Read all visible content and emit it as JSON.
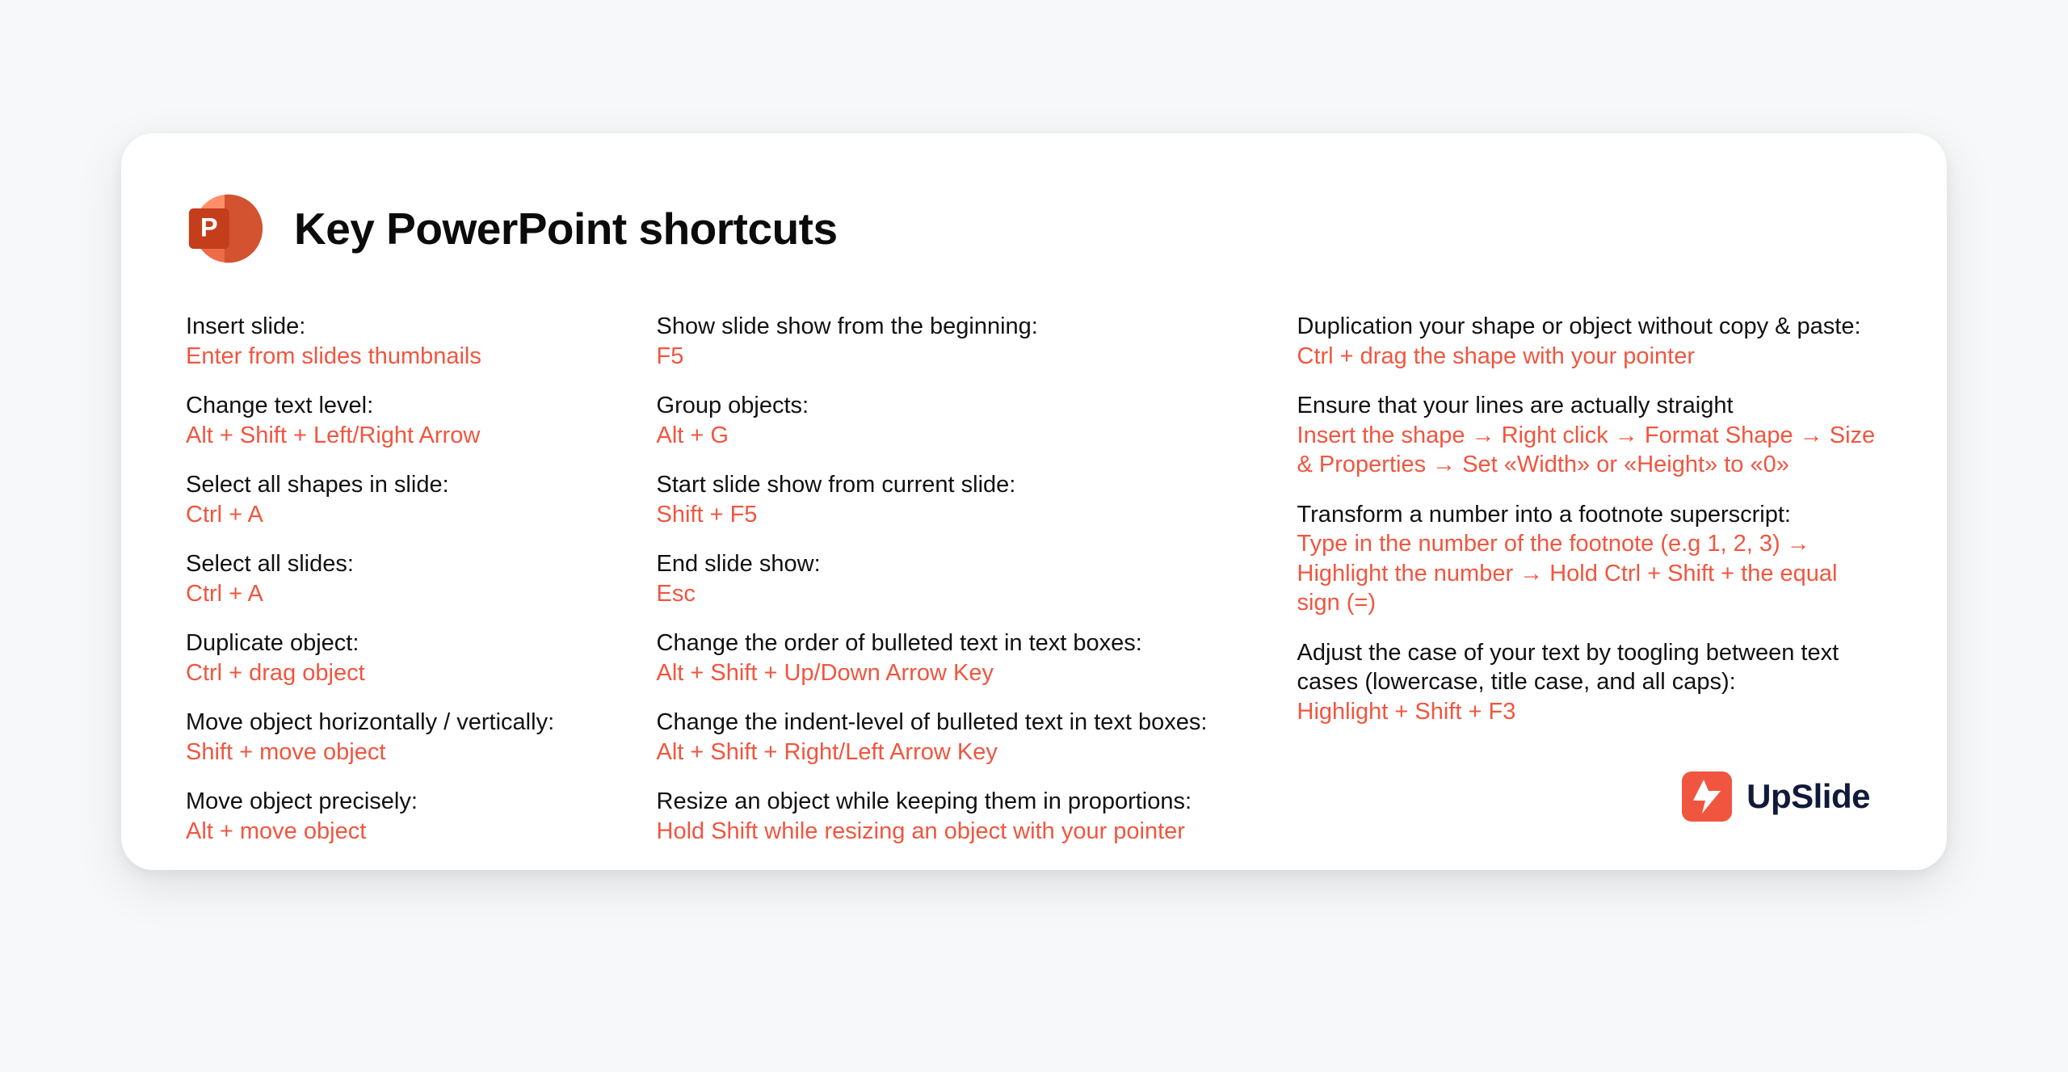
{
  "title": "Key PowerPoint shortcuts",
  "col1": [
    {
      "label": "Insert slide:",
      "keys": "Enter from slides thumbnails"
    },
    {
      "label": "Change text level:",
      "keys": "Alt + Shift + Left/Right Arrow"
    },
    {
      "label": "Select all shapes in slide:",
      "keys": "Ctrl + A"
    },
    {
      "label": "Select all slides:",
      "keys": "Ctrl + A"
    },
    {
      "label": "Duplicate object:",
      "keys": "Ctrl + drag object"
    },
    {
      "label": "Move object horizontally / vertically:",
      "keys": "Shift + move object"
    },
    {
      "label": "Move object precisely:",
      "keys": "Alt + move object"
    }
  ],
  "col2": [
    {
      "label": "Show slide show from the beginning:",
      "keys": "F5"
    },
    {
      "label": "Group objects:",
      "keys": "Alt + G"
    },
    {
      "label": "Start slide show from current slide:",
      "keys": "Shift + F5"
    },
    {
      "label": "End slide show:",
      "keys": "Esc"
    },
    {
      "label": "Change the order of bulleted text in text boxes:",
      "keys": "Alt + Shift + Up/Down Arrow Key"
    },
    {
      "label": "Change the indent-level of bulleted text in text boxes:",
      "keys": "Alt + Shift + Right/Left Arrow Key"
    },
    {
      "label": "Resize an object while keeping them in proportions:",
      "keys": "Hold Shift while resizing an object with your pointer"
    }
  ],
  "col3": [
    {
      "label": "Duplication your shape or object without copy & paste:",
      "keys": "Ctrl + drag the shape with your pointer"
    },
    {
      "label": "Ensure that your lines are actually straight",
      "keys": "Insert the shape → Right click → Format Shape → Size & Properties → Set «Width» or «Height» to «0»"
    },
    {
      "label": "Transform a number into a footnote superscript:",
      "keys": "Type in the number of the footnote (e.g 1, 2, 3) → Highlight the number → Hold Ctrl + Shift + the equal sign (=)"
    },
    {
      "label": "Adjust the case of your text by toogling between text cases (lowercase, title case, and all caps):",
      "keys": "Highlight + Shift + F3"
    }
  ],
  "brand": "UpSlide"
}
